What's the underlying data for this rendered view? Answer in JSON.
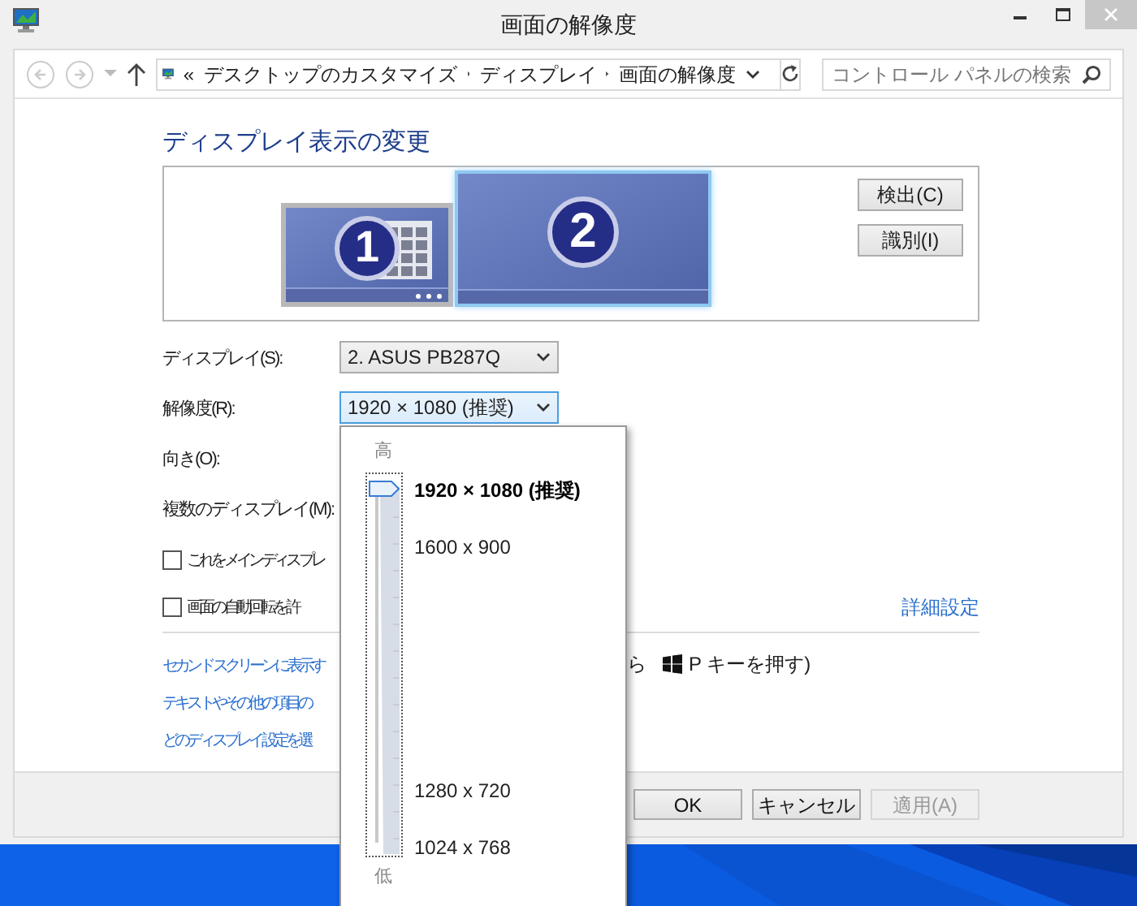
{
  "window": {
    "title": "画面の解像度"
  },
  "nav": {
    "prefix": "«",
    "breadcrumbs": [
      "デスクトップのカスタマイズ",
      "ディスプレイ",
      "画面の解像度"
    ],
    "search": {
      "placeholder": "コントロール パネルの検索"
    }
  },
  "heading": "ディスプレイ表示の変更",
  "monitors": [
    {
      "label": "1",
      "selected": false
    },
    {
      "label": "2",
      "selected": true
    }
  ],
  "preview_buttons": [
    "検出(C)",
    "識別(I)"
  ],
  "fields": [
    {
      "label": "ディスプレイ(S):",
      "value": "2. ASUS PB287Q",
      "open": false
    },
    {
      "label": "解像度(R):",
      "value": "1920 × 1080 (推奨)",
      "open": true
    },
    {
      "label": "向き(O):"
    },
    {
      "label": "複数のディスプレイ(M):"
    }
  ],
  "resolution_popup": {
    "high_label": "高",
    "low_label": "低",
    "level": 1,
    "options": [
      {
        "text": "1920 × 1080 (推奨)",
        "selected": true
      },
      {
        "text": "1600 x 900",
        "selected": false
      },
      {
        "text": "1280 x 720",
        "selected": false
      },
      {
        "text": "1024 x 768",
        "selected": false
      }
    ]
  },
  "checkboxes": [
    {
      "label": "これをメイン ディスプレ",
      "checked": false
    },
    {
      "label": "画面の自動回転を許",
      "checked": false
    }
  ],
  "advanced_link": "詳細設定",
  "links": [
    {
      "text": "セカンド スクリーンに表示す",
      "trailing": "ら",
      "key_text": "P キーを押す)"
    },
    {
      "text": "テキストやその他の項目の"
    },
    {
      "text": "どのディスプレイ設定を選"
    }
  ],
  "buttons": [
    {
      "label": "OK",
      "disabled": false
    },
    {
      "label": "キャンセル",
      "disabled": false
    },
    {
      "label": "適用(A)",
      "disabled": true
    }
  ]
}
